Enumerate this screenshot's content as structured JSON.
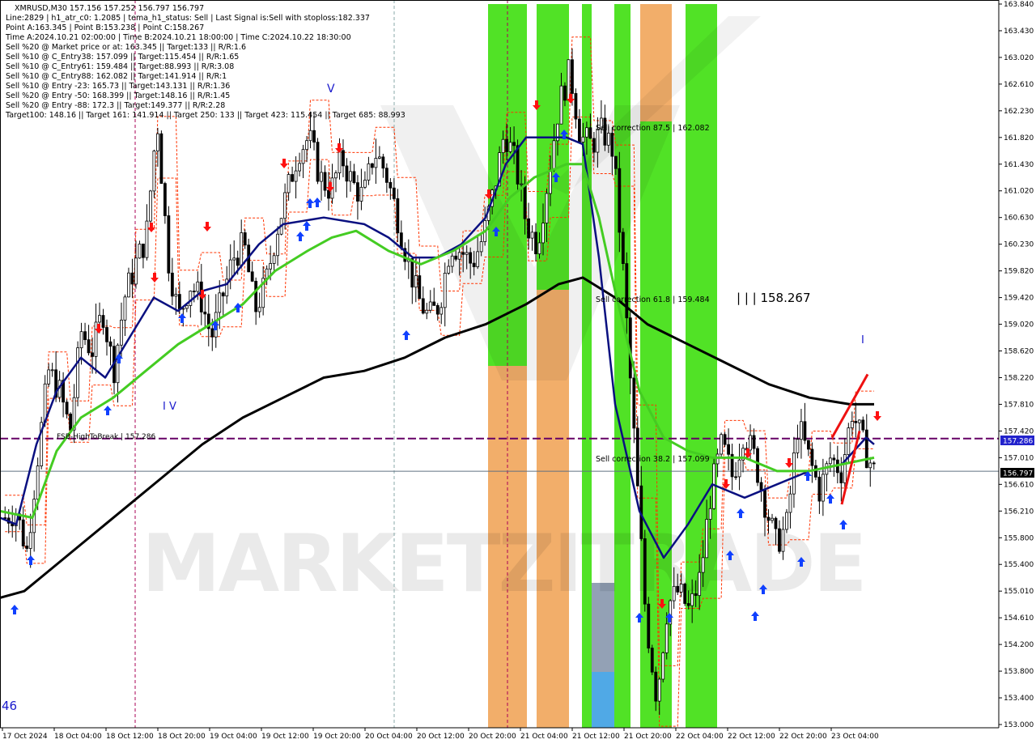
{
  "header": {
    "lines": [
      "XMRUSD,M30  157.156 157.252 156.797 156.797",
      "Line:2829 | h1_atr_c0: 1.2085 | tema_h1_status: Sell | Last Signal is:Sell with stoploss:182.337",
      "Point A:163.345 | Point B:153.238 | Point C:158.267",
      "Time A:2024.10.21 02:00:00 | Time B:2024.10.21 18:00:00 | Time C:2024.10.22 18:30:00",
      "Sell %20 @ Market price or at: 163.345 || Target:133 || R/R:1.6",
      "Sell %10 @ C_Entry38: 157.099 || Target:115.454 || R/R:1.65",
      "Sell %10 @ C_Entry61: 159.484 || Target:88.993 || R/R:3.08",
      "Sell %10 @ C_Entry88: 162.082 || Target:141.914 || R/R:1",
      "Sell %10 @ Entry -23: 165.73 || Target:143.131 || R/R:1.36",
      "Sell %20 @ Entry -50: 168.399 || Target:148.16 || R/R:1.45",
      "Sell %20 @ Entry -88: 172.3 || Target:149.377 || R/R:2.28",
      "Target100: 148.16 || Target 161: 141.914 || Target 250: 133 || Target 423: 115.454 || Target 685: 88.993"
    ]
  },
  "annotations": {
    "fsb": "FSB-HighToBreak | 157.286",
    "sell87": "Sell correction 87.5 | 162.082",
    "sell61": "Sell correction 61.8 | 159.484",
    "sell38": "Sell correction 38.2 | 157.099",
    "pointc": "| | | 158.267",
    "wave_v": "V",
    "wave_iv": "I V",
    "wave_i": "I",
    "bottom_left": "46",
    "watermark": "MARKETZITRADE"
  },
  "price_tags": {
    "fsb_value": "157.286",
    "current_value": "156.797"
  },
  "colors": {
    "bright_green": "#33dd00",
    "orange": "#f0a050",
    "grey_blue": "#8090a8",
    "sky_blue": "#44aaee",
    "ma_black": "#000000",
    "ma_navy": "#0a1080",
    "ma_green": "#44cc22",
    "fsb_line": "#660066",
    "current_line": "#607080",
    "candle_up": "#000000",
    "candle_down": "#000000",
    "arrow_up": "#1040ff",
    "arrow_down": "#ff1010",
    "channel": "#ff3300"
  },
  "chart_data": {
    "type": "candlestick",
    "symbol": "XMRUSD",
    "timeframe": "M30",
    "ylim": [
      153.0,
      163.8
    ],
    "y_ticks": [
      "163.840",
      "163.430",
      "163.020",
      "162.610",
      "162.230",
      "161.820",
      "161.430",
      "161.020",
      "160.630",
      "160.230",
      "159.820",
      "159.420",
      "159.020",
      "158.620",
      "158.220",
      "157.810",
      "157.420",
      "157.010",
      "156.610",
      "156.210",
      "155.800",
      "155.400",
      "155.010",
      "154.610",
      "154.200",
      "153.800",
      "153.400",
      "153.000"
    ],
    "x_ticks": [
      "17 Oct 2024",
      "18 Oct 04:00",
      "18 Oct 12:00",
      "18 Oct 20:00",
      "19 Oct 04:00",
      "19 Oct 12:00",
      "19 Oct 20:00",
      "20 Oct 04:00",
      "20 Oct 12:00",
      "20 Oct 20:00",
      "21 Oct 04:00",
      "21 Oct 12:00",
      "21 Oct 20:00",
      "22 Oct 04:00",
      "22 Oct 12:00",
      "22 Oct 20:00",
      "23 Oct 04:00"
    ],
    "levels": {
      "fsb_high_to_break": 157.286,
      "current_price": 156.797,
      "point_a": 163.345,
      "point_b": 153.238,
      "point_c": 158.267,
      "sell_correction_87_5": 162.082,
      "sell_correction_61_8": 159.484,
      "sell_correction_38_2": 157.099
    },
    "close_path": [
      156.1,
      156.2,
      155.6,
      157.0,
      158.3,
      158.0,
      157.4,
      158.9,
      158.6,
      159.2,
      158.3,
      159.4,
      159.9,
      160.3,
      162.1,
      160.0,
      159.1,
      159.6,
      159.4,
      158.8,
      159.4,
      160.0,
      160.2,
      159.2,
      159.6,
      160.4,
      161.0,
      161.6,
      161.8,
      161.2,
      161.0,
      161.5,
      161.1,
      160.9,
      161.6,
      161.3,
      160.7,
      160.0,
      159.4,
      159.1,
      159.3,
      160.2,
      160.1,
      159.9,
      160.3,
      161.0,
      161.9,
      161.4,
      160.5,
      160.2,
      161.2,
      162.3,
      162.8,
      161.8,
      161.7,
      161.9,
      161.6,
      159.6,
      157.1,
      154.6,
      153.4,
      154.8,
      155.0,
      154.7,
      155.2,
      156.5,
      157.2,
      156.7,
      157.4,
      157.0,
      156.3,
      155.7,
      156.0,
      157.5,
      157.0,
      156.5,
      157.0,
      156.8,
      157.7,
      157.2,
      156.8
    ],
    "series": [
      {
        "name": "",
        "points": [
          [
            0,
            154.9
          ],
          [
            30,
            155.0
          ],
          [
            60,
            155.3
          ],
          [
            100,
            155.7
          ],
          [
            150,
            156.2
          ],
          [
            200,
            156.7
          ],
          [
            250,
            157.2
          ],
          [
            300,
            157.6
          ],
          [
            350,
            157.9
          ],
          [
            400,
            158.2
          ],
          [
            450,
            158.3
          ],
          [
            500,
            158.5
          ],
          [
            550,
            158.8
          ],
          [
            600,
            159.0
          ],
          [
            650,
            159.3
          ],
          [
            690,
            159.6
          ],
          [
            720,
            159.7
          ],
          [
            760,
            159.4
          ],
          [
            800,
            159.0
          ],
          [
            850,
            158.7
          ],
          [
            900,
            158.4
          ],
          [
            950,
            158.1
          ],
          [
            1000,
            157.9
          ],
          [
            1050,
            157.8
          ],
          [
            1080,
            157.8
          ]
        ]
      },
      {
        "name": "",
        "points": [
          [
            0,
            156.1
          ],
          [
            20,
            156.0
          ],
          [
            45,
            157.2
          ],
          [
            70,
            158.0
          ],
          [
            100,
            158.5
          ],
          [
            130,
            158.2
          ],
          [
            160,
            158.8
          ],
          [
            190,
            159.4
          ],
          [
            220,
            159.2
          ],
          [
            250,
            159.5
          ],
          [
            280,
            159.6
          ],
          [
            320,
            160.2
          ],
          [
            350,
            160.5
          ],
          [
            400,
            160.6
          ],
          [
            450,
            160.5
          ],
          [
            480,
            160.3
          ],
          [
            510,
            160.0
          ],
          [
            540,
            160.0
          ],
          [
            570,
            160.2
          ],
          [
            600,
            160.6
          ],
          [
            625,
            161.4
          ],
          [
            650,
            161.8
          ],
          [
            700,
            161.8
          ],
          [
            720,
            161.7
          ],
          [
            740,
            160.0
          ],
          [
            760,
            157.8
          ],
          [
            790,
            156.2
          ],
          [
            820,
            155.5
          ],
          [
            850,
            156.0
          ],
          [
            880,
            156.6
          ],
          [
            920,
            156.4
          ],
          [
            960,
            156.6
          ],
          [
            1000,
            156.8
          ],
          [
            1040,
            156.9
          ],
          [
            1070,
            157.3
          ],
          [
            1080,
            157.2
          ]
        ]
      },
      {
        "name": "",
        "points": [
          [
            0,
            156.2
          ],
          [
            40,
            156.1
          ],
          [
            70,
            157.1
          ],
          [
            100,
            157.6
          ],
          [
            140,
            157.9
          ],
          [
            180,
            158.3
          ],
          [
            220,
            158.7
          ],
          [
            260,
            159.0
          ],
          [
            300,
            159.3
          ],
          [
            340,
            159.8
          ],
          [
            380,
            160.1
          ],
          [
            410,
            160.3
          ],
          [
            440,
            160.4
          ],
          [
            480,
            160.1
          ],
          [
            520,
            159.9
          ],
          [
            560,
            160.1
          ],
          [
            600,
            160.4
          ],
          [
            630,
            160.9
          ],
          [
            660,
            161.2
          ],
          [
            700,
            161.4
          ],
          [
            720,
            161.4
          ],
          [
            740,
            160.6
          ],
          [
            760,
            159.5
          ],
          [
            790,
            158.0
          ],
          [
            820,
            157.3
          ],
          [
            850,
            157.1
          ],
          [
            880,
            157.0
          ],
          [
            920,
            157.0
          ],
          [
            960,
            156.8
          ],
          [
            1000,
            156.8
          ],
          [
            1040,
            156.9
          ],
          [
            1080,
            157.0
          ]
        ]
      }
    ]
  }
}
